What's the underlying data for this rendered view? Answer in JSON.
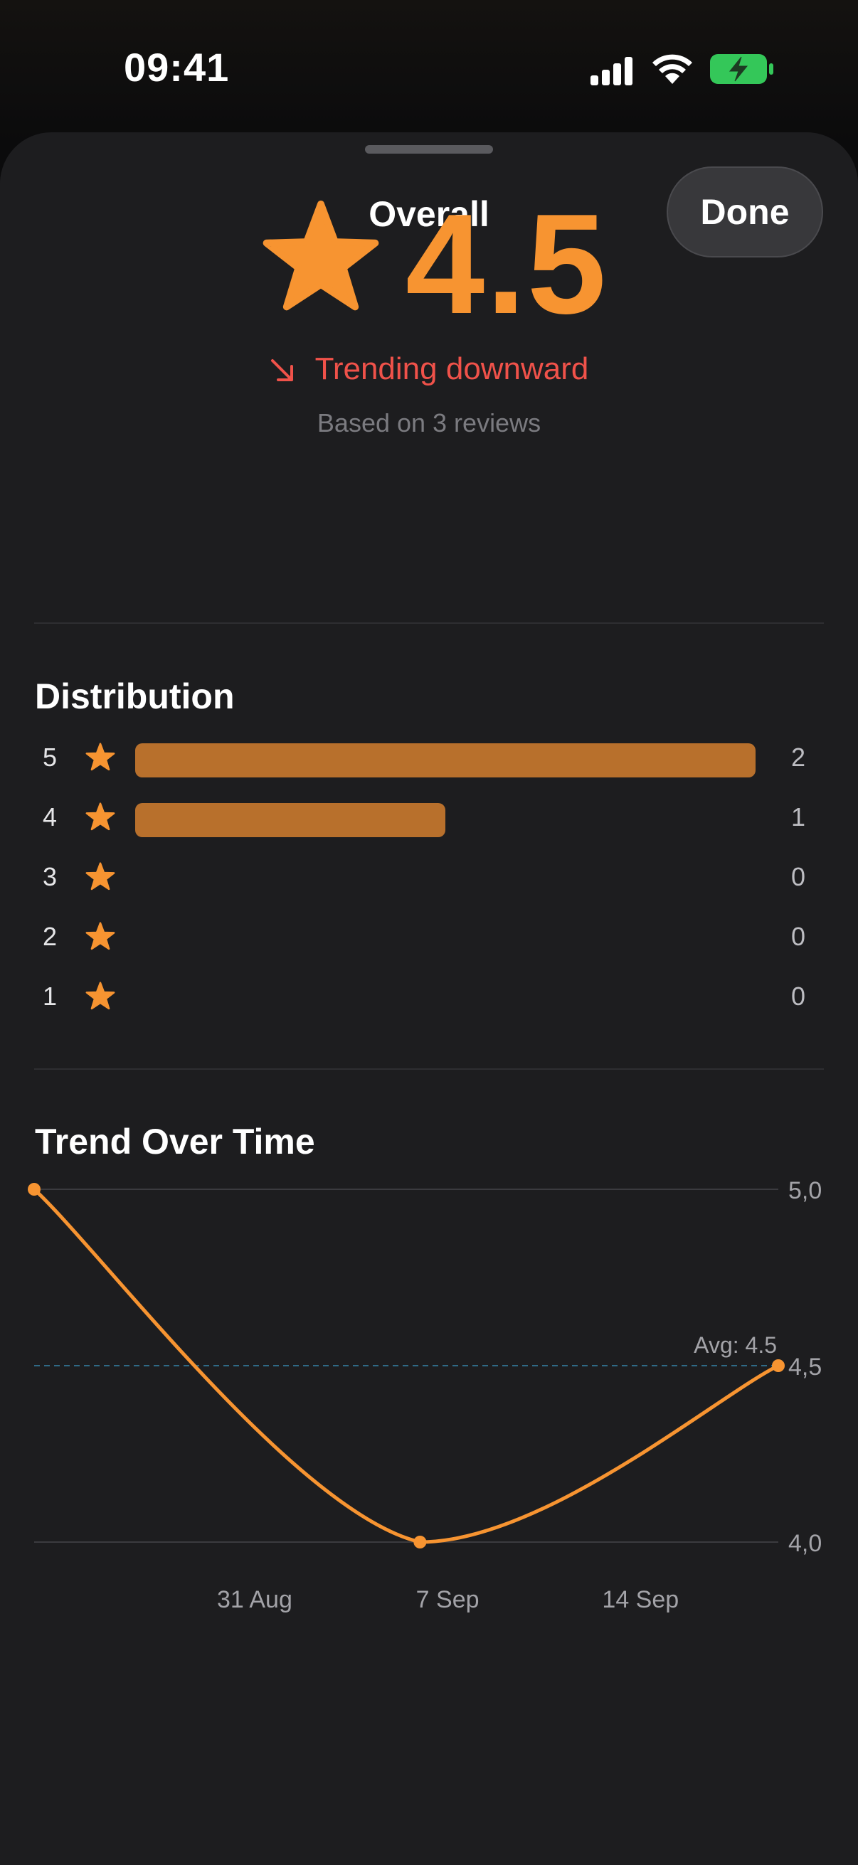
{
  "status_bar": {
    "time": "09:41"
  },
  "sheet": {
    "title": "Overall",
    "done_label": "Done"
  },
  "rating": {
    "value": "4.5",
    "trend_label": "Trending downward",
    "based_on": "Based on 3 reviews",
    "color": "#f79431",
    "trend_color": "#f0524a"
  },
  "distribution": {
    "title": "Distribution",
    "rows": [
      {
        "stars": "5",
        "count": "2",
        "fraction": 1.0
      },
      {
        "stars": "4",
        "count": "1",
        "fraction": 0.5
      },
      {
        "stars": "3",
        "count": "0",
        "fraction": 0
      },
      {
        "stars": "2",
        "count": "0",
        "fraction": 0
      },
      {
        "stars": "1",
        "count": "0",
        "fraction": 0
      }
    ]
  },
  "trend": {
    "title": "Trend Over Time"
  },
  "chart_data": {
    "type": "line",
    "x": [
      "2024-08-23",
      "2024-09-06",
      "2024-09-19"
    ],
    "y": [
      5.0,
      4.0,
      4.5
    ],
    "x_tick_labels": [
      "31 Aug",
      "7 Sep",
      "14 Sep"
    ],
    "x_tick_values": [
      "2024-08-31",
      "2024-09-07",
      "2024-09-14"
    ],
    "y_tick_labels": [
      "5,0",
      "4,5",
      "4,0"
    ],
    "y_tick_values": [
      5.0,
      4.5,
      4.0
    ],
    "ylim": [
      4.0,
      5.0
    ],
    "average": 4.5,
    "average_label": "Avg: 4.5",
    "line_color": "#f79431",
    "average_line_color": "#2f6a86",
    "grid": true
  }
}
